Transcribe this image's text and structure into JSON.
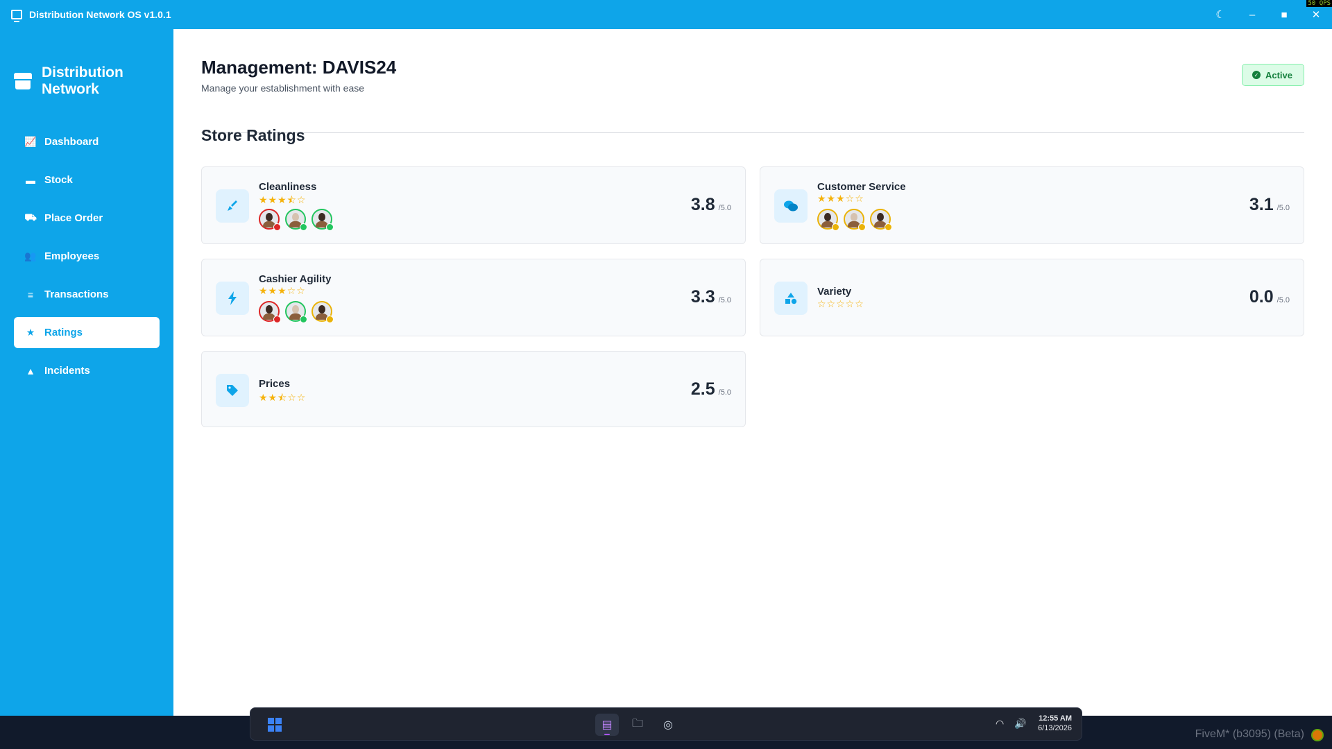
{
  "window": {
    "title": "Distribution Network OS v1.0.1",
    "fps": "50 QPS",
    "controls": {
      "theme_icon": "moon-icon",
      "minimize": "–",
      "maximize": "■",
      "close": "✕"
    }
  },
  "sidebar": {
    "brand": "Distribution Network",
    "items": [
      {
        "label": "Dashboard",
        "icon": "chart-line-icon",
        "glyph": "📈",
        "active": false
      },
      {
        "label": "Stock",
        "icon": "box-icon",
        "glyph": "▬",
        "active": false
      },
      {
        "label": "Place Order",
        "icon": "truck-icon",
        "glyph": "⛟",
        "active": false
      },
      {
        "label": "Employees",
        "icon": "users-icon",
        "glyph": "👥",
        "active": false
      },
      {
        "label": "Transactions",
        "icon": "coins-icon",
        "glyph": "≡",
        "active": false
      },
      {
        "label": "Ratings",
        "icon": "star-icon",
        "glyph": "★",
        "active": true
      },
      {
        "label": "Incidents",
        "icon": "warning-icon",
        "glyph": "▲",
        "active": false
      }
    ]
  },
  "header": {
    "title": "Management: DAVIS24",
    "subtitle": "Manage your establishment with ease",
    "status": "Active"
  },
  "ratings": {
    "section_title": "Store Ratings",
    "max_label": "/5.0",
    "cards": [
      {
        "label": "Cleanliness",
        "score": "3.8",
        "stars": "★★★⯪☆",
        "icon": "broom-icon",
        "avatar_colors": [
          "red",
          "green",
          "green"
        ]
      },
      {
        "label": "Customer Service",
        "score": "3.1",
        "stars": "★★★☆☆",
        "icon": "comments-icon",
        "avatar_colors": [
          "yellow",
          "yellow",
          "yellow"
        ]
      },
      {
        "label": "Cashier Agility",
        "score": "3.3",
        "stars": "★★★☆☆",
        "icon": "bolt-icon",
        "avatar_colors": [
          "red",
          "green",
          "yellow"
        ]
      },
      {
        "label": "Variety",
        "score": "0.0",
        "stars": "☆☆☆☆☆",
        "icon": "shapes-icon",
        "avatar_colors": []
      },
      {
        "label": "Prices",
        "score": "2.5",
        "stars": "★★⯪☆☆",
        "icon": "tag-icon",
        "avatar_colors": []
      }
    ]
  },
  "taskbar": {
    "apps": [
      {
        "icon": "store-icon",
        "glyph": "▤",
        "active": true
      },
      {
        "icon": "folder-icon",
        "glyph": "🗀",
        "active": false
      },
      {
        "icon": "compass-icon",
        "glyph": "◎",
        "active": false
      }
    ],
    "time": "12:55 AM",
    "date": "6/13/2026"
  },
  "watermark": "FiveM* (b3095) (Beta)"
}
